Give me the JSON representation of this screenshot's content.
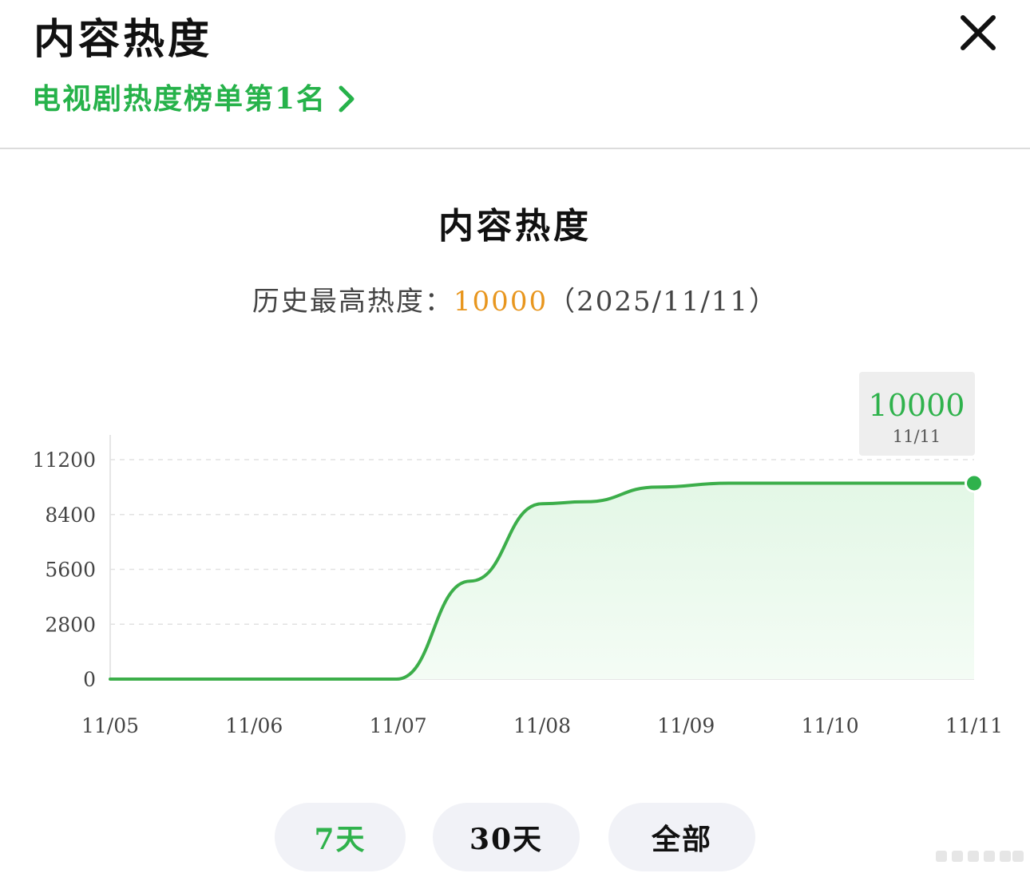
{
  "header": {
    "title": "内容热度",
    "rank_link": "电视剧热度榜单第1名",
    "close_icon": "close-icon",
    "chevron_icon": "chevron-right-icon"
  },
  "chart_section": {
    "title": "内容热度",
    "peak_label": "历史最高热度：",
    "peak_value": "10000",
    "peak_date": "（2025/11/11）"
  },
  "colors": {
    "accent": "#2fb24c",
    "line": "#3cae4a",
    "area": "#e3f7e6",
    "peak": "#e8961e"
  },
  "tooltip": {
    "value": "10000",
    "date": "11/11"
  },
  "chart_data": {
    "type": "area",
    "title": "内容热度",
    "xlabel": "",
    "ylabel": "",
    "categories": [
      "11/05",
      "11/06",
      "11/07",
      "11/08",
      "11/09",
      "11/10",
      "11/11"
    ],
    "yticks": [
      "0",
      "2800",
      "5600",
      "8400",
      "11200"
    ],
    "ylim": [
      0,
      12500
    ],
    "grid": true,
    "series": [
      {
        "points": [
          {
            "x": 0,
            "y": 0
          },
          {
            "x": 1,
            "y": 0
          },
          {
            "x": 1.99,
            "y": 0
          },
          {
            "x": 2.5,
            "y": 5000
          },
          {
            "x": 3.0,
            "y": 8950
          },
          {
            "x": 3.3,
            "y": 9050
          },
          {
            "x": 3.8,
            "y": 9800
          },
          {
            "x": 4.3,
            "y": 10000
          },
          {
            "x": 5.0,
            "y": 10000
          },
          {
            "x": 6.0,
            "y": 10000
          }
        ]
      }
    ],
    "highlight": {
      "x": "11/11",
      "y": 10000
    }
  },
  "range_tabs": [
    {
      "label": "7天",
      "active": true
    },
    {
      "label": "30天",
      "active": false
    },
    {
      "label": "全部",
      "active": false
    }
  ]
}
